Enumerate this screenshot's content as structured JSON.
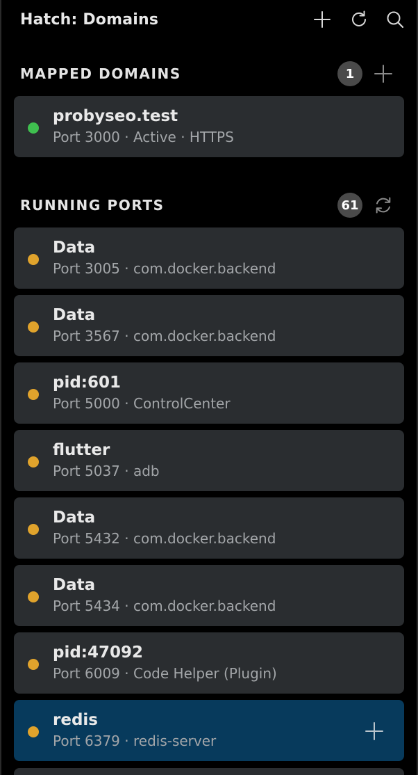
{
  "header": {
    "title": "Hatch: Domains"
  },
  "mapped": {
    "label": "MAPPED DOMAINS",
    "count": "1",
    "items": [
      {
        "name": "probyseo.test",
        "meta": "Port 3000 · Active · HTTPS",
        "status_color": "#3fbf4f"
      }
    ]
  },
  "running": {
    "label": "RUNNING PORTS",
    "count": "61",
    "items": [
      {
        "name": "Data",
        "meta": "Port 3005 · com.docker.backend",
        "status_color": "#e0a32c"
      },
      {
        "name": "Data",
        "meta": "Port 3567 · com.docker.backend",
        "status_color": "#e0a32c"
      },
      {
        "name": "pid:601",
        "meta": "Port 5000 · ControlCenter",
        "status_color": "#e0a32c"
      },
      {
        "name": "flutter",
        "meta": "Port 5037 · adb",
        "status_color": "#e0a32c"
      },
      {
        "name": "Data",
        "meta": "Port 5432 · com.docker.backend",
        "status_color": "#e0a32c"
      },
      {
        "name": "Data",
        "meta": "Port 5434 · com.docker.backend",
        "status_color": "#e0a32c"
      },
      {
        "name": "pid:47092",
        "meta": "Port 6009 · Code Helper (Plugin)",
        "status_color": "#e0a32c"
      },
      {
        "name": "redis",
        "meta": "Port 6379 · redis-server",
        "status_color": "#e0a32c"
      }
    ]
  },
  "colors": {
    "background": "#000000",
    "card": "#2a2d30",
    "card_selected": "#073a5c",
    "badge": "#4a4a4a"
  }
}
